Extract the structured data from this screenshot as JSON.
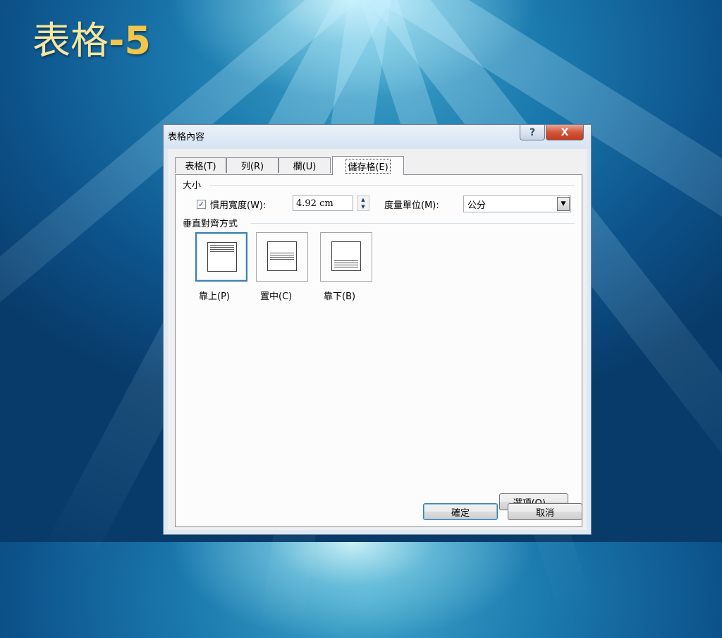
{
  "slide": {
    "title": "表格",
    "title_num": "-5"
  },
  "dialog": {
    "title": "表格內容",
    "help_glyph": "?",
    "close_glyph": "X",
    "tabs": [
      {
        "label": "表格(T)"
      },
      {
        "label": "列(R)"
      },
      {
        "label": "欄(U)"
      },
      {
        "label": "儲存格(E)"
      }
    ],
    "active_tab": "儲存格(E)",
    "size_group": {
      "label": "大小",
      "checkbox_checked": true,
      "checkbox_glyph": "✓",
      "preferred_width_label": "慣用寬度(W):",
      "width_value": "4.92 cm",
      "unit_label": "度量單位(M):",
      "unit_value": "公分"
    },
    "valign_group": {
      "label": "垂直對齊方式",
      "options": [
        {
          "label": "靠上(P)",
          "selected": true
        },
        {
          "label": "置中(C)",
          "selected": false
        },
        {
          "label": "靠下(B)",
          "selected": false
        }
      ]
    },
    "options_button": "選項(O)...",
    "ok_button": "確定",
    "cancel_button": "取消"
  }
}
